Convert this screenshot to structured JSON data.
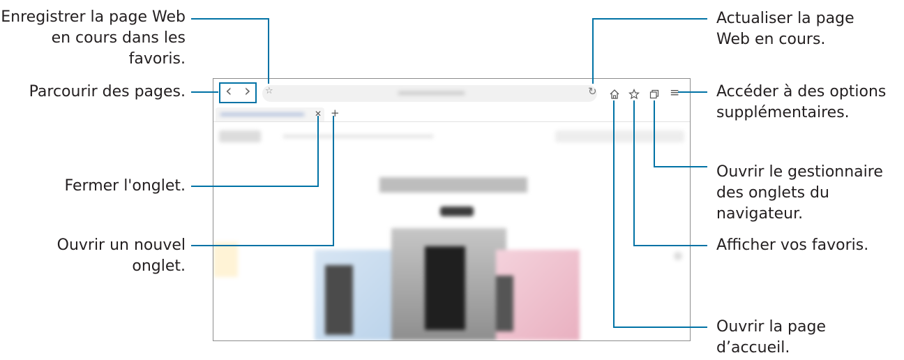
{
  "callouts": {
    "bookmark_save": "Enregistrer la page Web en cours dans les favoris.",
    "browse_pages": "Parcourir des pages.",
    "close_tab": "Fermer l'onglet.",
    "new_tab": "Ouvrir un nouvel onglet.",
    "refresh": "Actualiser la page Web en cours.",
    "more_options": "Accéder à des options supplémentaires.",
    "tab_manager": "Ouvrir le gestionnaire des onglets du navigateur.",
    "show_bookmarks": "Afficher vos favoris.",
    "home": "Ouvrir la page d’accueil."
  },
  "browser": {
    "back_glyph": "‹",
    "forward_glyph": "›",
    "star_glyph": "☆",
    "close_tab_glyph": "✕",
    "new_tab_glyph": "+",
    "refresh_glyph": "↻",
    "home_icon": "home-icon",
    "bookmarks_icon": "star-icon",
    "tabs_icon": "tabs-icon",
    "menu_glyph": "≡"
  },
  "colors": {
    "leader": "#0072a5",
    "text": "#231f20",
    "frame": "#8c8c8c"
  }
}
